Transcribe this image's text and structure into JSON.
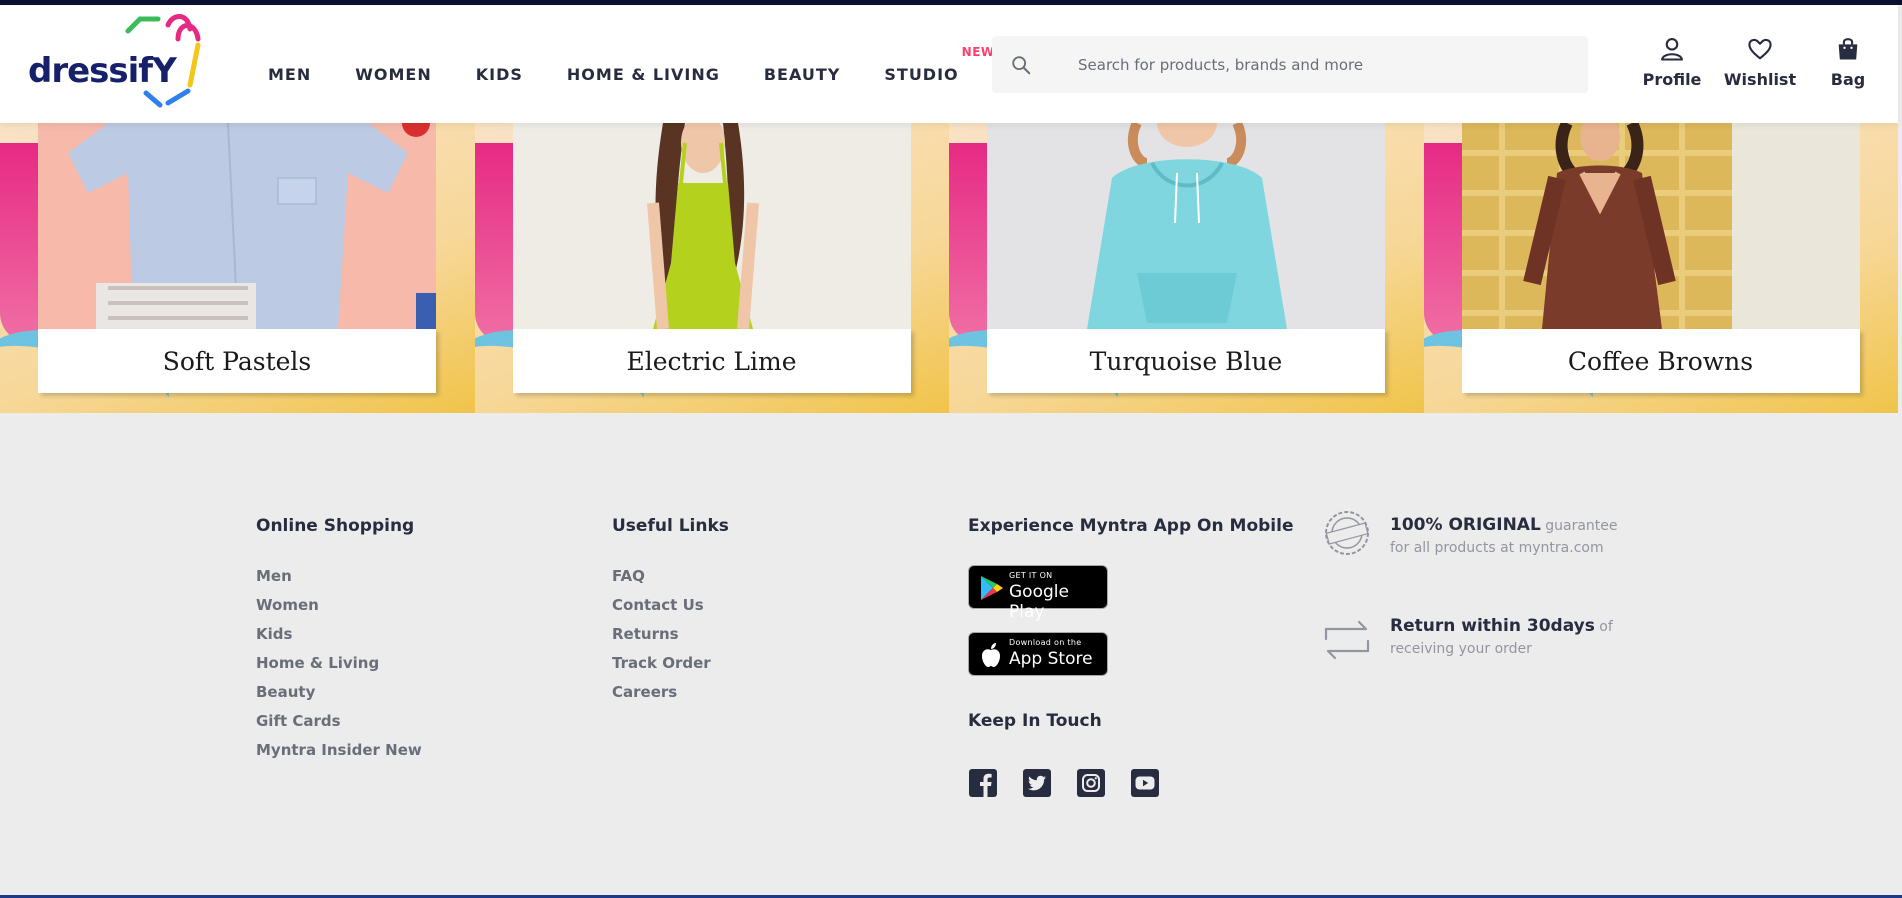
{
  "header": {
    "logo_text": "dressifY",
    "nav": [
      {
        "label": "MEN"
      },
      {
        "label": "WOMEN"
      },
      {
        "label": "KIDS"
      },
      {
        "label": "HOME & LIVING"
      },
      {
        "label": "BEAUTY"
      },
      {
        "label": "STUDIO",
        "badge": "NEW"
      }
    ],
    "search": {
      "placeholder": "Search for products, brands and more",
      "icon": "search-icon"
    },
    "actions": [
      {
        "label": "Profile",
        "icon": "user-icon"
      },
      {
        "label": "Wishlist",
        "icon": "heart-icon"
      },
      {
        "label": "Bag",
        "icon": "bag-icon"
      }
    ]
  },
  "banner": {
    "tiles": [
      {
        "caption": "Soft Pastels"
      },
      {
        "caption": "Electric Lime"
      },
      {
        "caption": "Turquoise Blue"
      },
      {
        "caption": "Coffee Browns"
      }
    ]
  },
  "footer": {
    "online_shopping": {
      "title": "Online Shopping",
      "links": [
        "Men",
        "Women",
        "Kids",
        "Home & Living",
        "Beauty",
        "Gift Cards",
        "Myntra Insider New"
      ]
    },
    "useful_links": {
      "title": "Useful Links",
      "links": [
        "FAQ",
        "Contact Us",
        "Returns",
        "Track Order",
        "Careers"
      ]
    },
    "app": {
      "title": "Experience Myntra App On Mobile",
      "google_play": {
        "small": "GET IT ON",
        "big": "Google Play"
      },
      "app_store": {
        "small": "Download on the",
        "big": "App Store"
      }
    },
    "keep_in_touch": {
      "title": "Keep In Touch",
      "socials": [
        "facebook-icon",
        "twitter-icon",
        "instagram-icon",
        "youtube-icon"
      ]
    },
    "promos": [
      {
        "bold": "100% ORIGINAL",
        "rest": " guarantee for all products at myntra.com",
        "icon": "original-seal-icon"
      },
      {
        "bold": "Return within 30days",
        "rest": " of receiving your order",
        "icon": "return-30-icon"
      }
    ]
  },
  "colors": {
    "brand_dark": "#16206b",
    "accent_pink": "#ff3f6c",
    "text_primary": "#282c3f",
    "text_secondary": "#696e79",
    "footer_bg": "#ececec"
  }
}
